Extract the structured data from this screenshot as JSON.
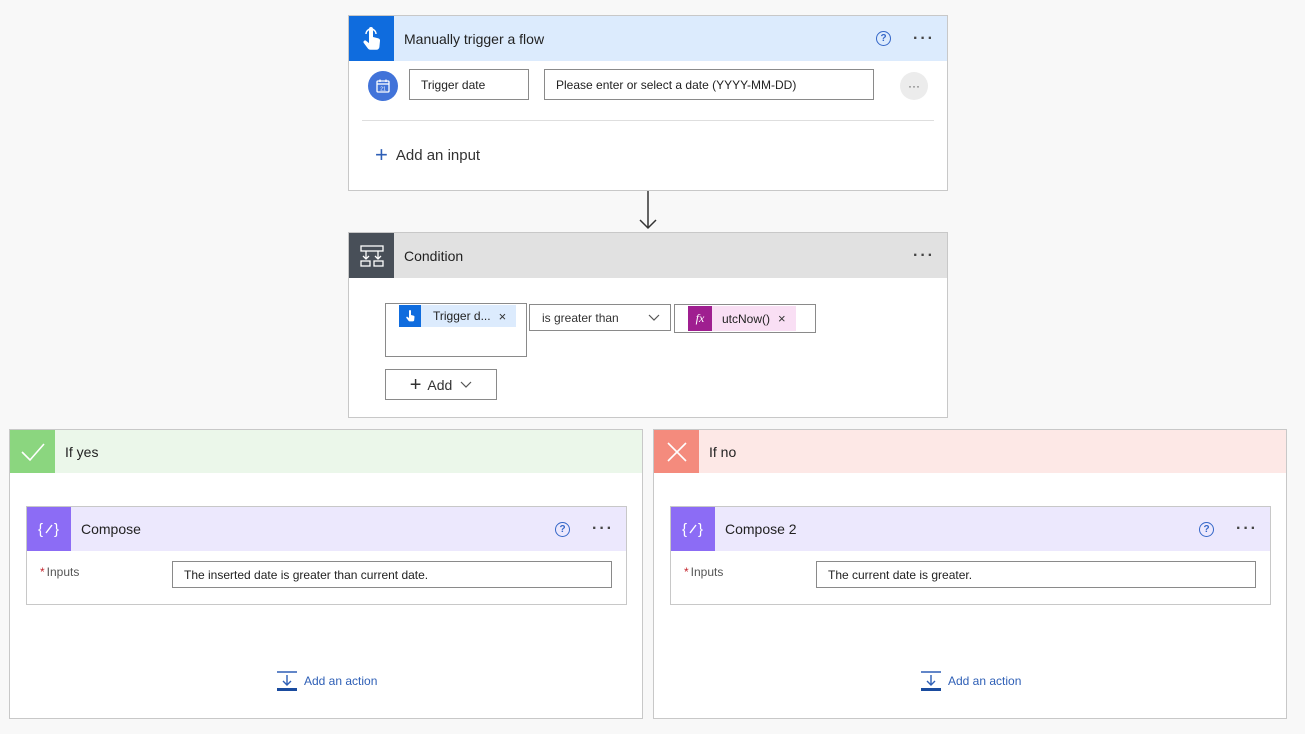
{
  "trigger": {
    "title": "Manually trigger a flow",
    "help_icon": "?",
    "more_icon": "···",
    "input_name": "Trigger date",
    "input_placeholder": "Please enter or select a date (YYYY-MM-DD)",
    "row_more": "···",
    "add_input_label": "Add an input"
  },
  "condition": {
    "title": "Condition",
    "more_icon": "···",
    "left_token": "Trigger d...",
    "operator": "is greater than",
    "fx_label": "fx",
    "right_token": "utcNow()",
    "remove_icon": "×",
    "add_button": "Add"
  },
  "branches": {
    "yes": {
      "title": "If yes",
      "action": {
        "title": "Compose",
        "inputs_label": "Inputs",
        "required_mark": "*",
        "inputs_value": "The inserted date is greater than current date."
      },
      "add_action": "Add an action"
    },
    "no": {
      "title": "If no",
      "action": {
        "title": "Compose 2",
        "inputs_label": "Inputs",
        "required_mark": "*",
        "inputs_value": "The current date is greater."
      },
      "add_action": "Add an action"
    }
  },
  "colors": {
    "trigger_accent": "#0f6cde",
    "trigger_header": "#dcebfd",
    "condition_accent": "#484f58",
    "condition_header": "#e1e1e1",
    "yes_accent": "#8bd67f",
    "yes_header": "#ebf7ea",
    "no_accent": "#f48b7d",
    "no_header": "#fde8e6",
    "compose_accent": "#8c6cf5",
    "compose_header": "#ece8fd",
    "fx_accent": "#9f1f90"
  }
}
